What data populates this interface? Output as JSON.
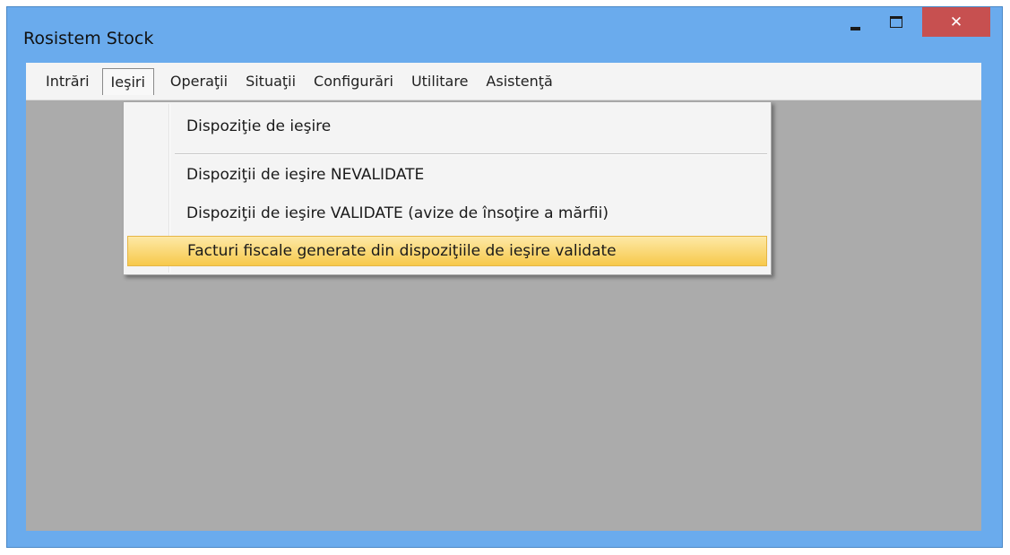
{
  "window": {
    "title": "Rosistem Stock",
    "controls": {
      "minimize_icon": "minimize-icon",
      "maximize_icon": "maximize-icon",
      "close_label": "✕"
    }
  },
  "menubar": {
    "items": [
      {
        "label": "Intrări"
      },
      {
        "label": "Ieşiri"
      },
      {
        "label": "Operaţii"
      },
      {
        "label": "Situaţii"
      },
      {
        "label": "Configurări"
      },
      {
        "label": "Utilitare"
      },
      {
        "label": "Asistenţă"
      }
    ],
    "active_index": 1
  },
  "dropdown": {
    "items": [
      {
        "label": "Dispoziţie de ieşire"
      },
      {
        "label": "Dispoziţii de ieşire NEVALIDATE"
      },
      {
        "label": "Dispoziţii de ieşire VALIDATE (avize de însoţire a mărfii)"
      },
      {
        "label": "Facturi fiscale generate din dispoziţiile de ieşire validate"
      }
    ],
    "highlighted_index": 3
  },
  "colors": {
    "titlebar": "#6aabed",
    "close_button": "#c75050",
    "client_area": "#ababab",
    "highlight": "#f7c94b"
  }
}
